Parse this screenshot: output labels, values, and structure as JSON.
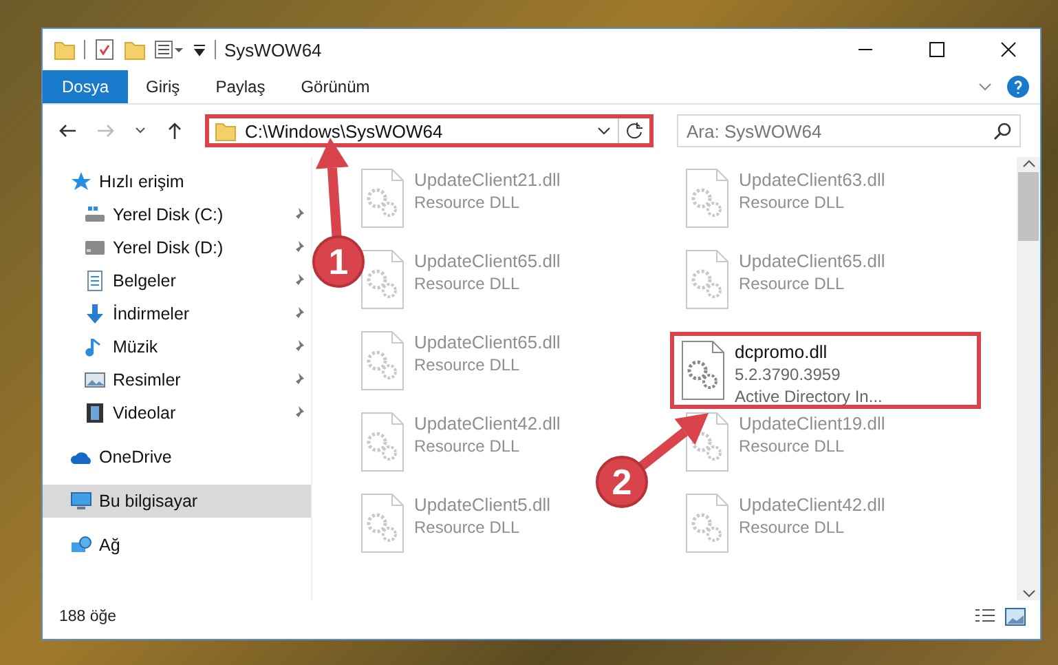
{
  "window": {
    "title": "SysWOW64"
  },
  "ribbon_tabs": [
    {
      "label": "Dosya",
      "selected": true
    },
    {
      "label": "Giriş",
      "selected": false
    },
    {
      "label": "Paylaş",
      "selected": false
    },
    {
      "label": "Görünüm",
      "selected": false
    }
  ],
  "address_bar": {
    "path": "C:\\Windows\\SysWOW64",
    "highlighted": true
  },
  "search": {
    "placeholder": "Ara: SysWOW64"
  },
  "sidebar": {
    "items": [
      {
        "label": "Hızlı erişim",
        "kind": "star",
        "selected": false,
        "children": [
          {
            "label": "Yerel Disk (C:)",
            "kind": "systemdrive",
            "pinned": true,
            "selected": false
          },
          {
            "label": "Yerel Disk (D:)",
            "kind": "drive",
            "pinned": true,
            "selected": false
          },
          {
            "label": "Belgeler",
            "kind": "documents",
            "pinned": true,
            "selected": false
          },
          {
            "label": "İndirmeler",
            "kind": "downloads",
            "pinned": true,
            "selected": false
          },
          {
            "label": "Müzik",
            "kind": "music",
            "pinned": true,
            "selected": false
          },
          {
            "label": "Resimler",
            "kind": "pictures",
            "pinned": true,
            "selected": false
          },
          {
            "label": "Videolar",
            "kind": "videos",
            "pinned": true,
            "selected": false
          }
        ]
      },
      {
        "label": "OneDrive",
        "kind": "cloud",
        "selected": false
      },
      {
        "label": "Bu bilgisayar",
        "kind": "computer",
        "selected": true
      },
      {
        "label": "Ağ",
        "kind": "network",
        "selected": false
      }
    ]
  },
  "files": [
    {
      "name": "UpdateClient21.dll",
      "description": "Resource DLL",
      "blurred": true,
      "highlighted": false
    },
    {
      "name": "UpdateClient63.dll",
      "description": "Resource DLL",
      "blurred": true,
      "highlighted": false
    },
    {
      "name": "UpdateClient65.dll",
      "description": "Resource DLL",
      "blurred": true,
      "highlighted": false
    },
    {
      "name": "UpdateClient65.dll",
      "description": "Resource DLL",
      "blurred": true,
      "highlighted": false
    },
    {
      "name": "UpdateClient65.dll",
      "description": "Resource DLL",
      "blurred": true,
      "highlighted": false
    },
    {
      "name": "dcpromo.dll",
      "version": "5.2.3790.3959",
      "description": "Active Directory In...",
      "blurred": false,
      "highlighted": true
    },
    {
      "name": "UpdateClient42.dll",
      "description": "Resource DLL",
      "blurred": true,
      "highlighted": false
    },
    {
      "name": "UpdateClient19.dll",
      "description": "Resource DLL",
      "blurred": true,
      "highlighted": false
    },
    {
      "name": "UpdateClient5.dll",
      "description": "Resource DLL",
      "blurred": true,
      "highlighted": false
    },
    {
      "name": "UpdateClient42.dll",
      "description": "Resource DLL",
      "blurred": true,
      "highlighted": false
    }
  ],
  "status_bar": {
    "count": "188 öğe"
  },
  "annotations": [
    {
      "label": "1"
    },
    {
      "label": "2"
    }
  ]
}
